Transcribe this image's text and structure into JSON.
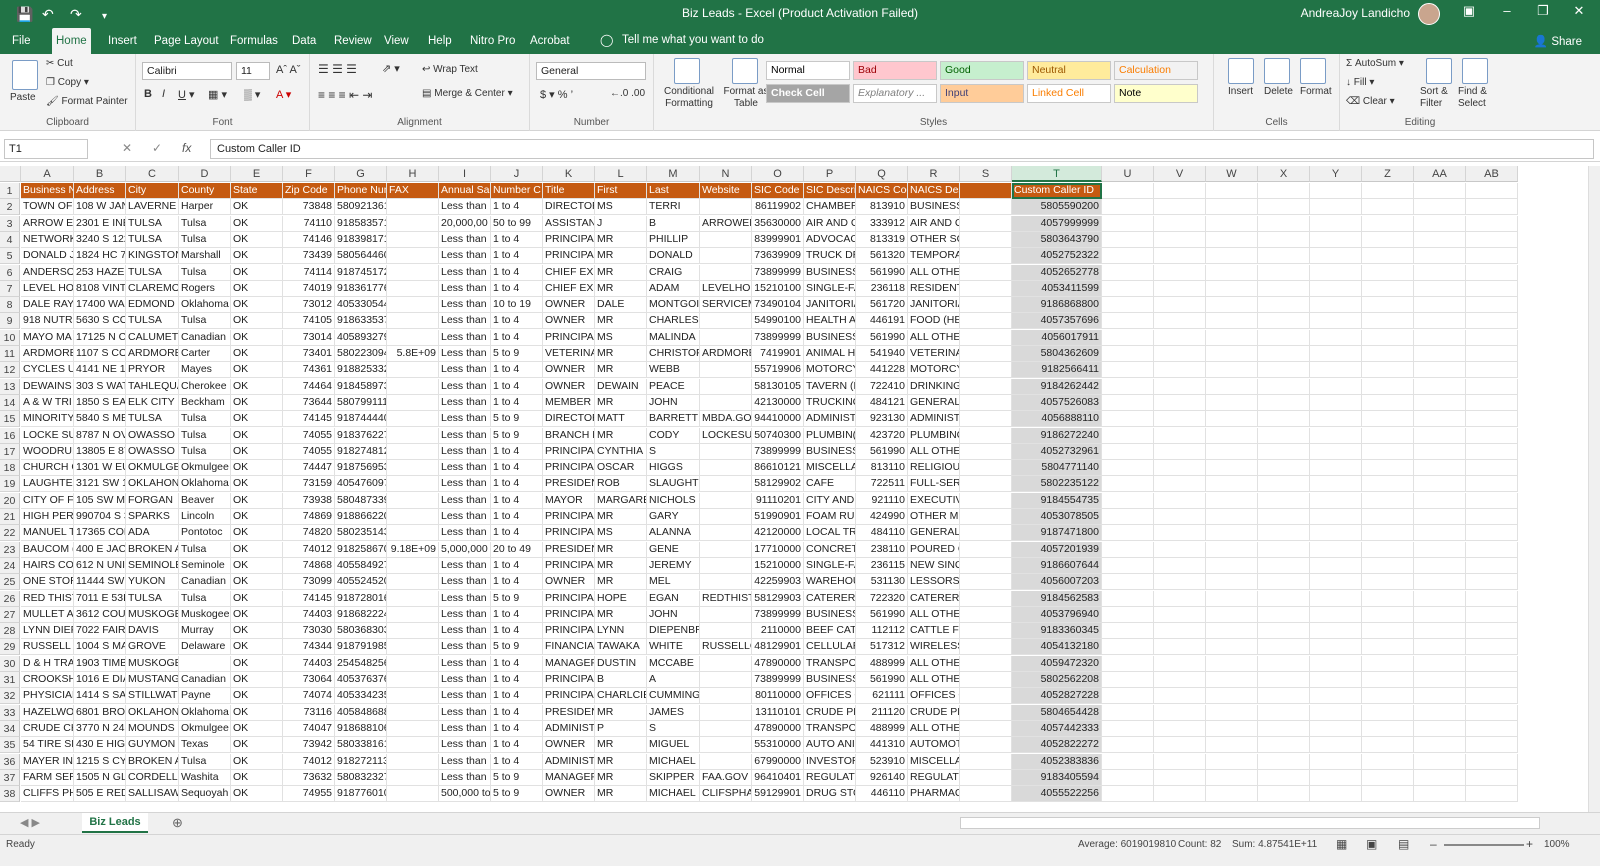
{
  "titlebar": {
    "title": "Biz Leads  -  Excel (Product Activation Failed)",
    "user": "AndreaJoy Landicho",
    "save_icon": "save-icon",
    "undo_icon": "undo-icon",
    "redo_icon": "redo-icon",
    "customize_icon": "customize-qat-icon"
  },
  "tabs": [
    "File",
    "Home",
    "Insert",
    "Page Layout",
    "Formulas",
    "Data",
    "Review",
    "View",
    "Help",
    "Nitro Pro",
    "Acrobat"
  ],
  "active_tab": "Home",
  "tell_me": "Tell me what you want to do",
  "share": "Share",
  "ribbon": {
    "clipboard": {
      "paste": "Paste",
      "cut": "Cut",
      "copy": "Copy",
      "format_painter": "Format Painter",
      "label": "Clipboard"
    },
    "font": {
      "name": "Calibri",
      "size": "11",
      "label": "Font"
    },
    "alignment": {
      "wrap": "Wrap Text",
      "merge": "Merge & Center",
      "label": "Alignment"
    },
    "number": {
      "format": "General",
      "label": "Number"
    },
    "styles": {
      "conditional": "Conditional Formatting",
      "format_table": "Format as Table",
      "label": "Styles",
      "items": [
        "Normal",
        "Bad",
        "Good",
        "Neutral",
        "Calculation",
        "Check Cell",
        "Explanatory ...",
        "Input",
        "Linked Cell",
        "Note"
      ]
    },
    "cells": {
      "insert": "Insert",
      "delete": "Delete",
      "format": "Format",
      "label": "Cells"
    },
    "editing": {
      "autosum": "AutoSum",
      "fill": "Fill",
      "clear": "Clear",
      "sort": "Sort & Filter",
      "find": "Find & Select",
      "label": "Editing"
    }
  },
  "formula_bar": {
    "name_box": "T1",
    "formula": "Custom Caller ID"
  },
  "columns": [
    "A",
    "B",
    "C",
    "D",
    "E",
    "F",
    "G",
    "H",
    "I",
    "J",
    "K",
    "L",
    "M",
    "N",
    "O",
    "P",
    "Q",
    "R",
    "S",
    "T",
    "U",
    "V",
    "W",
    "X",
    "Y",
    "Z",
    "AA",
    "AB"
  ],
  "selected_column": "T",
  "header_row": [
    "Business N",
    "Address",
    "City",
    "County",
    "State",
    "Zip Code",
    "Phone Num",
    "FAX",
    "Annual Sa",
    "Number C",
    "Title",
    "First",
    "Last",
    "Website",
    "SIC Code",
    "SIC Descri",
    "NAICS Coc",
    "NAICS Description",
    "",
    "Custom Caller ID"
  ],
  "rows": [
    [
      "TOWN OF",
      "108 W JAN",
      "LAVERNE",
      "Harper",
      "OK",
      "73848",
      "5809213612",
      "",
      "Less than",
      "1 to 4",
      "DIRECTOR",
      "MS",
      "TERRI",
      "",
      "86119902",
      "CHAMBER",
      "813910",
      "BUSINESS ASSOCIAT",
      "",
      "5805590200"
    ],
    [
      "ARROW EI",
      "2301 E INE",
      "TULSA",
      "Tulsa",
      "OK",
      "74110",
      "9185835711",
      "",
      "20,000,00",
      "50 to 99",
      "ASSISTAN",
      "J",
      "B",
      "ARROWEN",
      "35630000",
      "AIR AND G",
      "333912",
      "AIR AND GAS COMPI",
      "",
      "4057999999"
    ],
    [
      "NETWORK",
      "3240 S 122",
      "TULSA",
      "Tulsa",
      "OK",
      "74146",
      "9183981717",
      "",
      "Less than",
      "1 to 4",
      "PRINCIPA",
      "MR",
      "PHILLIP",
      "",
      "83999901",
      "ADVOCAC",
      "813319",
      "OTHER SOCIAL ADVC",
      "",
      "5803643790"
    ],
    [
      "DONALD J",
      "1824 HC 7(",
      "KINGSTON",
      "Marshall",
      "OK",
      "73439",
      "5805644608",
      "",
      "Less than",
      "1 to 4",
      "PRINCIPA",
      "MR",
      "DONALD",
      "",
      "73639909",
      "TRUCK DR",
      "561320",
      "TEMPORARY HELP SE",
      "",
      "4052752322"
    ],
    [
      "ANDERSO",
      "253 HAZEL",
      "TULSA",
      "Tulsa",
      "OK",
      "74114",
      "9187451723",
      "",
      "Less than",
      "1 to 4",
      "CHIEF EXE",
      "MR",
      "CRAIG",
      "",
      "73899999",
      "BUSINESS",
      "561990",
      "ALL OTHER SUPPORT",
      "",
      "4052652778"
    ],
    [
      "LEVEL HOI",
      "8108 VINT",
      "CLAREMO",
      "Rogers",
      "OK",
      "74019",
      "9183617767",
      "",
      "Less than",
      "1 to 4",
      "CHIEF EXE",
      "MR",
      "ADAM",
      "LEVELHON",
      "15210100",
      "SINGLE-FA",
      "236118",
      "RESIDENTIAL REMOD",
      "",
      "4053411599"
    ],
    [
      "DALE RAY",
      "17400 WA",
      "EDMOND",
      "Oklahoma",
      "OK",
      "73012",
      "4053305444",
      "",
      "Less than",
      "10 to 19",
      "OWNER",
      "DALE",
      "MONTGOI",
      "SERVICEM",
      "73490104",
      "JANITORIA",
      "561720",
      "JANITORIAL SERVICE",
      "",
      "9186868800"
    ],
    [
      "918 NUTRI",
      "5630 S CO",
      "TULSA",
      "Tulsa",
      "OK",
      "74105",
      "9186335377",
      "",
      "Less than",
      "1 to 4",
      "OWNER",
      "MR",
      "CHARLES",
      "",
      "54990100",
      "HEALTH A",
      "446191",
      "FOOD (HEALTH) SUP",
      "",
      "4057357696"
    ],
    [
      "MAYO MA",
      "17125 N C",
      "CALUMET",
      "Canadian",
      "OK",
      "73014",
      "4058932795",
      "",
      "Less than",
      "1 to 4",
      "PRINCIPA",
      "MS",
      "MALINDA",
      "",
      "73899999",
      "BUSINESS",
      "561990",
      "ALL OTHER SUPPORT",
      "",
      "4056017911"
    ],
    [
      "ARDMORE",
      "1107 S CO",
      "ARDMORE",
      "Carter",
      "OK",
      "73401",
      "5802230943",
      "5.8E+09",
      "Less than",
      "5 to 9",
      "VETERINA",
      "MR",
      "CHRISTOP",
      "ARDMORE",
      "7419901",
      "ANIMAL H",
      "541940",
      "VETERINARY SERVICI",
      "",
      "5804362609"
    ],
    [
      "CYCLES UI",
      "4141 NE 1",
      "PRYOR",
      "Mayes",
      "OK",
      "74361",
      "9188253326",
      "",
      "Less than",
      "1 to 4",
      "OWNER",
      "MR",
      "WEBB",
      "",
      "55719906",
      "MOTORCY",
      "441228",
      "MOTORCYCLE, ATV,",
      "",
      "9182566411"
    ],
    [
      "DEWAINS",
      "303 S WAT",
      "TAHLEQUA",
      "Cherokee",
      "OK",
      "74464",
      "9184589736",
      "",
      "Less than",
      "1 to 4",
      "OWNER",
      "DEWAIN",
      "PEACE",
      "",
      "58130105",
      "TAVERN (E",
      "722410",
      "DRINKING PLACES (A",
      "",
      "9184262442"
    ],
    [
      "A & W TRI",
      "1850 S EAS",
      "ELK CITY",
      "Beckham",
      "OK",
      "73644",
      "5807991119",
      "",
      "Less than",
      "1 to 4",
      "MEMBER",
      "MR",
      "JOHN",
      "",
      "42130000",
      "TRUCKING",
      "484121",
      "GENERAL FREIGHT TF",
      "",
      "4057526083"
    ],
    [
      "MINORITY",
      "5840 S ME",
      "TULSA",
      "Tulsa",
      "OK",
      "74145",
      "9187444400",
      "",
      "Less than",
      "5 to 9",
      "DIRECTOR",
      "MATT",
      "BARRETT",
      "MBDA.GO",
      "94410000",
      "ADMINIST",
      "923130",
      "ADMINISTRATION O",
      "",
      "4056888110"
    ],
    [
      "LOCKE SUI",
      "8787 N OV",
      "OWASSO",
      "Tulsa",
      "OK",
      "74055",
      "9183762278",
      "",
      "Less than",
      "5 to 9",
      "BRANCH M",
      "MR",
      "CODY",
      "LOCKESUF",
      "50740300",
      "PLUMBIN(",
      "423720",
      "PLUMBING AND HEA",
      "",
      "9186272240"
    ],
    [
      "WOODRUI",
      "13805 E 87",
      "OWASSO",
      "Tulsa",
      "OK",
      "74055",
      "9182748128",
      "",
      "Less than",
      "1 to 4",
      "PRINCIPA",
      "CYNTHIA",
      "S",
      "",
      "73899999",
      "BUSINESS",
      "561990",
      "ALL OTHER SUPPORT",
      "",
      "4052732961"
    ],
    [
      "CHURCH C",
      "1301 W EU",
      "OKMULGE",
      "Okmulgee",
      "OK",
      "74447",
      "9187569539",
      "",
      "Less than",
      "1 to 4",
      "PRINCIPA",
      "OSCAR",
      "HIGGS",
      "",
      "86610121",
      "MISCELLA",
      "813110",
      "RELIGIOUS ORGANIZ",
      "",
      "5804771140"
    ],
    [
      "LAUGHTEF",
      "3121 SW 1",
      "OKLAHON",
      "Oklahoma",
      "OK",
      "73159",
      "4054760976",
      "",
      "Less than",
      "1 to 4",
      "PRESIDEN",
      "ROB",
      "SLAUGHTERBECK",
      "",
      "58129902",
      "CAFE",
      "722511",
      "FULL-SERVICE RESTA",
      "",
      "5802235122"
    ],
    [
      "CITY OF FC",
      "105 SW MA",
      "FORGAN",
      "Beaver",
      "OK",
      "73938",
      "5804873393",
      "",
      "Less than",
      "1 to 4",
      "MAYOR",
      "MARGARE",
      "NICHOLS",
      "",
      "91110201",
      "CITY AND",
      "921110",
      "EXECUTIVE OFFICES",
      "",
      "9184554735"
    ],
    [
      "HIGH PERI",
      "990704 S 3",
      "SPARKS",
      "Lincoln",
      "OK",
      "74869",
      "9188662200",
      "",
      "Less than",
      "1 to 4",
      "PRINCIPA",
      "MR",
      "GARY",
      "",
      "51990901",
      "FOAM RUI",
      "424990",
      "OTHER MISCELLANEC",
      "",
      "4053078505"
    ],
    [
      "MANUEL T",
      "17365 COL",
      "ADA",
      "Pontotoc",
      "OK",
      "74820",
      "5802351431",
      "",
      "Less than",
      "1 to 4",
      "PRINCIPA",
      "MS",
      "ALANNA",
      "",
      "42120000",
      "LOCAL TRI",
      "484110",
      "GENERAL FREIGHT TF",
      "",
      "9187471800"
    ],
    [
      "BAUCOM (",
      "400 E JACK",
      "BROKEN A",
      "Tulsa",
      "OK",
      "74012",
      "9182586700",
      "9.18E+09",
      "5,000,000",
      "20 to 49",
      "PRESIDEN",
      "MR",
      "GENE",
      "",
      "17710000",
      "CONCRETI",
      "238110",
      "POURED CONCRETE F",
      "",
      "4057201939"
    ],
    [
      "HAIRS COI",
      "612 N UNI",
      "SEMINOLE",
      "Seminole",
      "OK",
      "74868",
      "4055849270",
      "",
      "Less than",
      "1 to 4",
      "PRINCIPA",
      "MR",
      "JEREMY",
      "",
      "15210000",
      "SINGLE-FA",
      "236115",
      "NEW SINGLE-FAMILY",
      "",
      "9186607644"
    ],
    [
      "ONE STOR",
      "11444 SW",
      "YUKON",
      "Canadian",
      "OK",
      "73099",
      "4055245200",
      "",
      "Less than",
      "1 to 4",
      "OWNER",
      "MR",
      "MEL",
      "",
      "42259903",
      "WAREHOU",
      "531130",
      "LESSORS OF MINIWA",
      "",
      "4056007203"
    ],
    [
      "RED THIST",
      "7011 E 53F",
      "TULSA",
      "Tulsa",
      "OK",
      "74145",
      "9187280168",
      "",
      "Less than",
      "5 to 9",
      "PRINCIPA",
      "HOPE",
      "EGAN",
      "REDTHISTI",
      "58129903",
      "CATERERS",
      "722320",
      "CATERERS",
      "",
      "9184562583"
    ],
    [
      "MULLET A",
      "3612 COUI",
      "MUSKOGE",
      "Muskogee",
      "OK",
      "74403",
      "9186822242",
      "",
      "Less than",
      "1 to 4",
      "PRINCIPA",
      "MR",
      "JOHN",
      "",
      "73899999",
      "BUSINESS",
      "561990",
      "ALL OTHER SUPPORT",
      "",
      "4053796940"
    ],
    [
      "LYNN DIEF",
      "7022 FAIR",
      "DAVIS",
      "Murray",
      "OK",
      "73030",
      "5803683035",
      "",
      "Less than",
      "1 to 4",
      "PRINCIPA",
      "LYNN",
      "DIEPENBROCK",
      "",
      "2110000",
      "BEEF CATT",
      "112112",
      "CATTLE FEEDLOTS",
      "",
      "9183360345"
    ],
    [
      "RUSSELL C",
      "1004 S MA",
      "GROVE",
      "Delaware",
      "OK",
      "74344",
      "9187919853",
      "",
      "Less than",
      "5 to 9",
      "FINANCIA",
      "TAWAKA",
      "WHITE",
      "RUSSELLC",
      "48129901",
      "CELLULAR",
      "517312",
      "WIRELESS TELECOMN",
      "",
      "4054132180"
    ],
    [
      "D & H TRA",
      "1903 TIMB",
      "MUSKOGEE",
      "",
      "OK",
      "74403",
      "2545482561",
      "",
      "Less than",
      "1 to 4",
      "MANAGEF",
      "DUSTIN",
      "MCCABE",
      "",
      "47890000",
      "TRANSPOI",
      "488999",
      "ALL OTHER SUPPORT",
      "",
      "4059472320"
    ],
    [
      "CROOKSH",
      "1016 E DIA",
      "MUSTANG",
      "Canadian",
      "OK",
      "73064",
      "4053763765",
      "",
      "Less than",
      "1 to 4",
      "PRINCIPA",
      "B",
      "A",
      "",
      "73899999",
      "BUSINESS",
      "561990",
      "ALL OTHER SUPPORT",
      "",
      "5802562208"
    ],
    [
      "PHYSICIAN",
      "1414 S SAI",
      "STILLWATI",
      "Payne",
      "OK",
      "74074",
      "4053342352",
      "",
      "Less than",
      "1 to 4",
      "PRINCIPA",
      "CHARLCIE",
      "CUMMING",
      "",
      "80110000",
      "OFFICES O",
      "621111",
      "OFFICES OF PHYSICI/",
      "",
      "4052827228"
    ],
    [
      "HAZELWO",
      "6801 BRO/",
      "OKLAHON",
      "Oklahoma",
      "OK",
      "73116",
      "4058486884",
      "",
      "Less than",
      "1 to 4",
      "PRESIDEN",
      "MR",
      "JAMES",
      "",
      "13110101",
      "CRUDE PE",
      "211120",
      "CRUDE PETROLEUM E",
      "",
      "5804654428"
    ],
    [
      "CRUDE CH",
      "3770 N 24I",
      "MOUNDS",
      "Okmulgee",
      "OK",
      "74047",
      "9186881069",
      "",
      "Less than",
      "1 to 4",
      "ADMINIST",
      "P",
      "S",
      "",
      "47890000",
      "TRANSPOI",
      "488999",
      "ALL OTHER SUPPORT",
      "",
      "4057442333"
    ],
    [
      "54 TIRE SH",
      "430 E HIGI",
      "GUYMON",
      "Texas",
      "OK",
      "73942",
      "5803381616",
      "",
      "Less than",
      "1 to 4",
      "OWNER",
      "MR",
      "MIGUEL",
      "",
      "55310000",
      "AUTO ANI",
      "441310",
      "AUTOMOTIVE PARTS",
      "",
      "4052822272"
    ],
    [
      "MAYER IN",
      "1215 S CYI",
      "BROKEN A",
      "Tulsa",
      "OK",
      "74012",
      "9182721134",
      "",
      "Less than",
      "1 to 4",
      "ADMINIST",
      "MR",
      "MICHAEL",
      "",
      "67990000",
      "INVESTOR",
      "523910",
      "MISCELLANEOUS INT",
      "",
      "4052383836"
    ],
    [
      "FARM SER",
      "1505 N GL",
      "CORDELL",
      "Washita",
      "OK",
      "73632",
      "5808323275",
      "",
      "Less than",
      "5 to 9",
      "MANAGEF",
      "MR",
      "SKIPPER",
      "FAA.GOV",
      "96410401",
      "REGULATI(",
      "926140",
      "REGULATION OF AGF",
      "",
      "9183405594"
    ],
    [
      "CLIFFS PH",
      "505 E RED",
      "SALLISAW",
      "Sequoyah",
      "OK",
      "74955",
      "9187760100",
      "",
      "500,000 to",
      "5 to 9",
      "OWNER",
      "MR",
      "MICHAEL",
      "CLIFSPHAI",
      "59129901",
      "DRUG STO",
      "446110",
      "PHARMACIES AND D(",
      "",
      "4055522256"
    ]
  ],
  "sheet": {
    "name": "Biz Leads"
  },
  "status": {
    "ready": "Ready",
    "average": "Average: 6019019810",
    "count": "Count: 82",
    "sum": "Sum: 4.87541E+11",
    "zoom": "100%"
  }
}
